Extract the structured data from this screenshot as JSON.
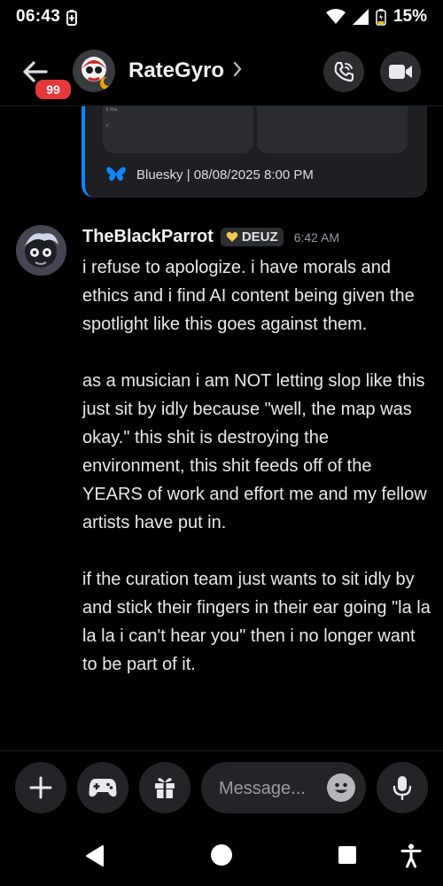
{
  "status_bar": {
    "time": "06:43",
    "battery": "15%"
  },
  "header": {
    "unread_count": "99",
    "channel_name": "RateGyro"
  },
  "embed": {
    "source": "Bluesky | 08/08/2025 8:00 PM",
    "tiny_text_1": "k You",
    "tiny_text_2": "c",
    "accent": "#1185fe"
  },
  "message": {
    "author": "TheBlackParrot",
    "tag": "DEUZ",
    "timestamp": "6:42 AM",
    "paragraphs": [
      "i refuse to apologize. i have morals and ethics and i find AI content being given the spotlight like this goes against them.",
      "as a musician i am NOT letting slop like this just sit by idly because \"well, the map was okay.\" this shit is destroying the environment, this shit feeds off of the YEARS of work and effort me and my fellow artists have put in.",
      "if the curation team just wants to sit idly by and stick their fingers in their ear going \"la la la la i can't hear you\" then i no longer want to be part of it."
    ]
  },
  "composer": {
    "placeholder": "Message..."
  },
  "icons": {
    "add": "plus-icon",
    "games": "gamepad-icon",
    "gift": "gift-icon",
    "emoji": "emoji-icon",
    "mic": "microphone-icon",
    "call": "phone-call-icon",
    "video": "video-camera-icon"
  }
}
